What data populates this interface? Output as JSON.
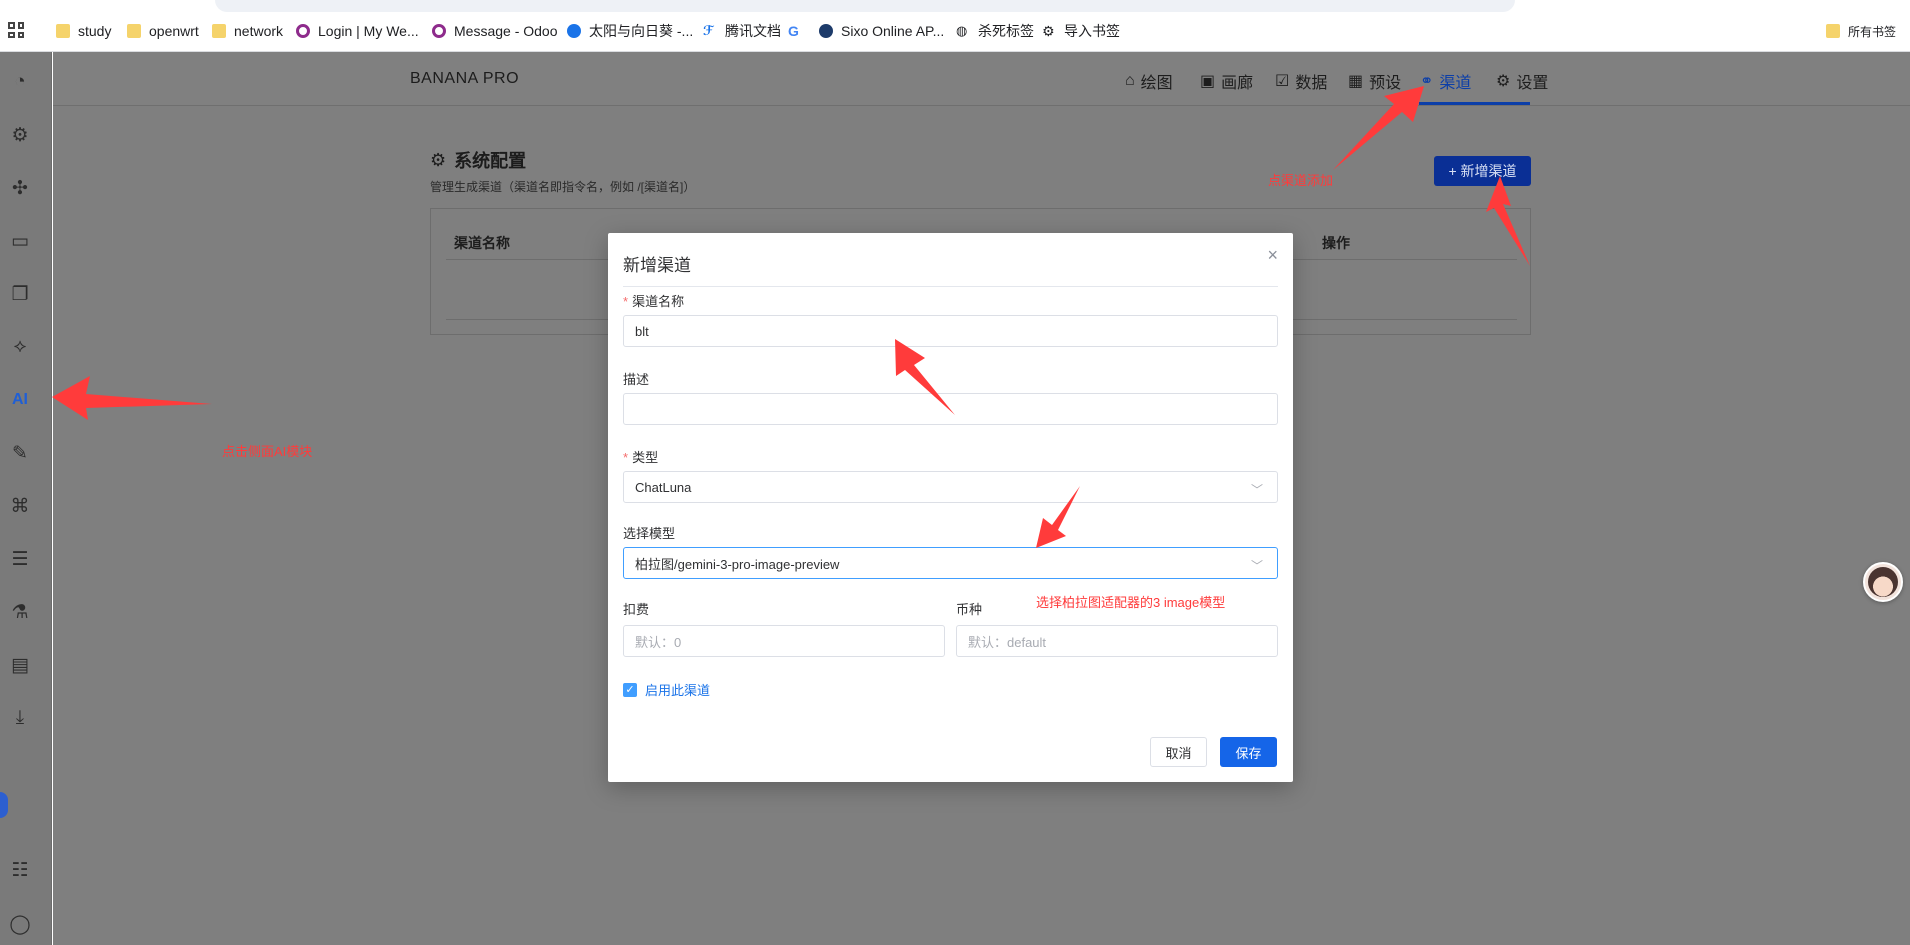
{
  "bookmarks": [
    {
      "label": "study",
      "icon": "folder-icon"
    },
    {
      "label": "openwrt",
      "icon": "folder-icon"
    },
    {
      "label": "network",
      "icon": "folder-icon"
    },
    {
      "label": "Login | My We...",
      "icon": "ring-icon"
    },
    {
      "label": "Message - Odoo",
      "icon": "ring-icon"
    },
    {
      "label": "太阳与向日葵 -...",
      "icon": "blue-circle-icon"
    },
    {
      "label": "腾讯文档",
      "icon": "tencent-docs-icon"
    },
    {
      "label": "",
      "icon": "google-icon"
    },
    {
      "label": "Sixo Online AP...",
      "icon": "sixo-icon"
    },
    {
      "label": "杀死标签",
      "icon": "globe-icon"
    },
    {
      "label": "导入书签",
      "icon": "gear-icon"
    }
  ],
  "bookmarks_right": {
    "label": "所有书签"
  },
  "app": {
    "brand": "BANANA PRO",
    "nav": [
      {
        "label": "绘图",
        "icon": "brush-icon"
      },
      {
        "label": "画廊",
        "icon": "image-icon"
      },
      {
        "label": "数据",
        "icon": "data-icon"
      },
      {
        "label": "预设",
        "icon": "preset-icon"
      },
      {
        "label": "渠道",
        "icon": "channel-icon",
        "active": true
      },
      {
        "label": "设置",
        "icon": "gear-icon"
      }
    ]
  },
  "page": {
    "title": "系统配置",
    "description": "管理生成渠道（渠道名即指令名，例如 /[渠道名]）",
    "add_button": "+ 新增渠道",
    "table_headers": {
      "name": "渠道名称",
      "actions": "操作"
    }
  },
  "modal": {
    "title": "新增渠道",
    "close_glyph": "×",
    "fields": {
      "name": {
        "label": "渠道名称",
        "required": true,
        "value": "blt"
      },
      "description": {
        "label": "描述",
        "value": ""
      },
      "type": {
        "label": "类型",
        "required": true,
        "value": "ChatLuna"
      },
      "model": {
        "label": "选择模型",
        "value": "柏拉图/gemini-3-pro-image-preview"
      },
      "cost": {
        "label": "扣费",
        "placeholder": "默认：0"
      },
      "currency": {
        "label": "币种",
        "placeholder": "默认：default"
      }
    },
    "enable": {
      "label": "启用此渠道",
      "checked": true
    },
    "buttons": {
      "cancel": "取消",
      "save": "保存"
    }
  },
  "annotations": {
    "click_ai": "点击侧面AI模块",
    "add_channel": "点渠道添加",
    "select_model": "选择柏拉图适配器的3 image模型"
  },
  "colors": {
    "accent": "#1565e8",
    "annotation": "#ff3b3b",
    "overlay": "#7f7f7f"
  }
}
